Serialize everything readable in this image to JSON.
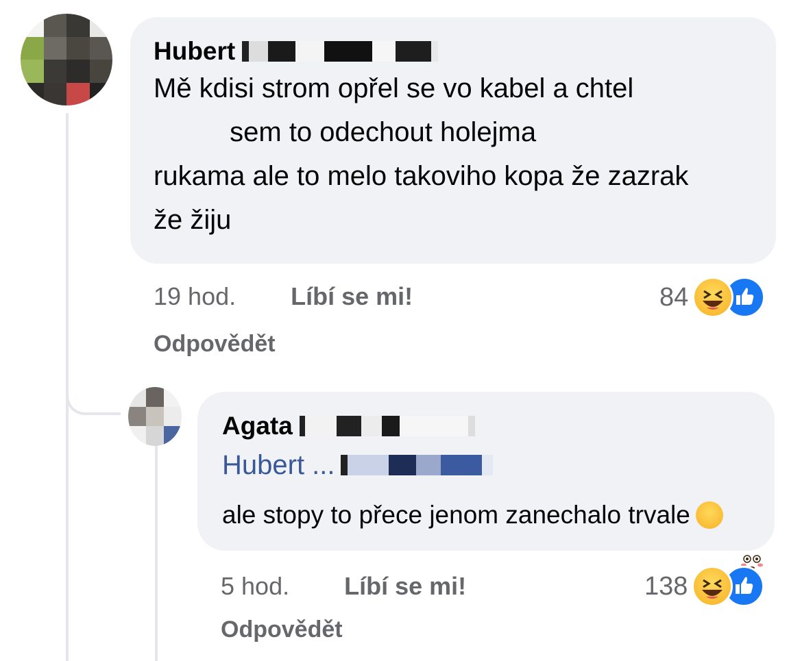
{
  "comment": {
    "author": "Hubert",
    "text_lines": [
      "Mě kdisi strom opřel se vo kabel a chtel",
      "          sem to odechout holejma",
      "rukama ale to melo takoviho kopa že zazrak",
      "že žiju"
    ],
    "time": "19 hod.",
    "like_label": "Líbí se mi!",
    "reply_label": "Odpovědět",
    "reaction_count": "84",
    "reaction_icons": [
      "haha-emoji-icon",
      "like-reaction-icon"
    ]
  },
  "reply": {
    "author": "Agata",
    "mention": "Hubert ...",
    "text": "ale stopy to přece jenom zanechalo trvale",
    "text_emoji": "flushed-emoji-icon",
    "time": "5 hod.",
    "like_label": "Líbí se mi!",
    "reply_label": "Odpovědět",
    "reaction_count": "138",
    "reaction_icons": [
      "haha-emoji-icon",
      "like-reaction-icon"
    ]
  },
  "colors": {
    "bubble": "#f0f2f5",
    "meta_text": "#65676b",
    "mention": "#385898",
    "like_reaction": "#1877f2",
    "thread_line": "#e4e6eb"
  }
}
